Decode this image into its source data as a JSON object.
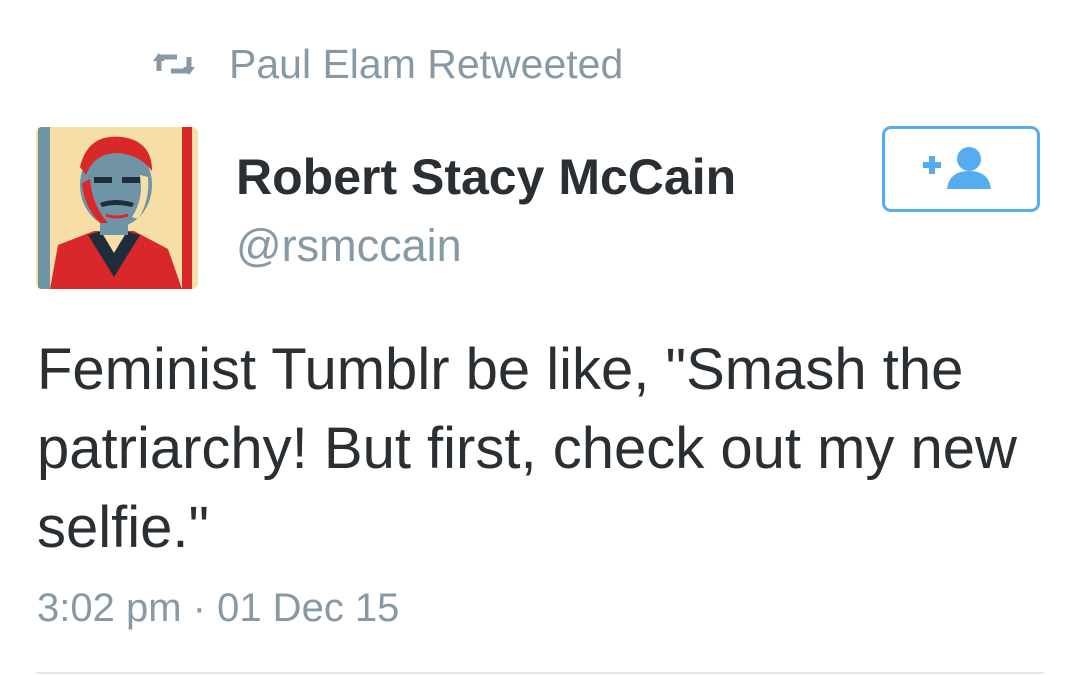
{
  "retweet": {
    "icon": "retweet-icon",
    "text": "Paul Elam Retweeted"
  },
  "author": {
    "avatar_icon": "avatar-portrait",
    "display_name": "Robert Stacy McCain",
    "handle": "@rsmccain"
  },
  "follow_button": {
    "icon": "add-user-icon",
    "accent_color": "#55acee"
  },
  "tweet": {
    "text": "Feminist Tumblr be like, \"Smash the patriarchy! But first, check out my new selfie.\"",
    "timestamp": "3:02 pm · 01 Dec 15"
  },
  "colors": {
    "text_primary": "#292f33",
    "text_secondary": "#8899a6",
    "accent": "#55acee",
    "divider": "#e1e8ed"
  }
}
